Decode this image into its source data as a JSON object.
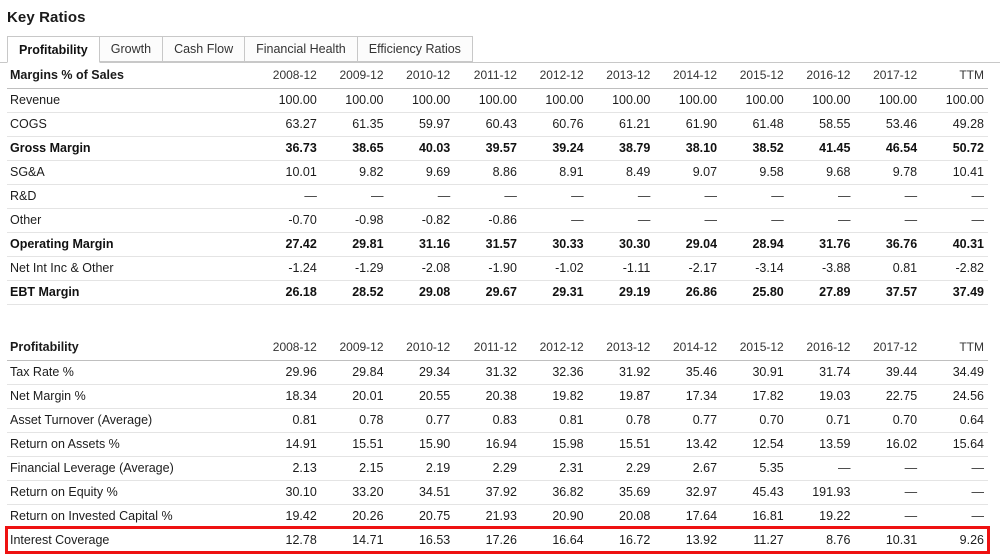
{
  "page_title": "Key Ratios",
  "tabs": [
    {
      "label": "Profitability",
      "active": true
    },
    {
      "label": "Growth",
      "active": false
    },
    {
      "label": "Cash Flow",
      "active": false
    },
    {
      "label": "Financial Health",
      "active": false
    },
    {
      "label": "Efficiency Ratios",
      "active": false
    }
  ],
  "columns": [
    "2008-12",
    "2009-12",
    "2010-12",
    "2011-12",
    "2012-12",
    "2013-12",
    "2014-12",
    "2015-12",
    "2016-12",
    "2017-12",
    "TTM"
  ],
  "highlight_color": "#ee1111",
  "sections": [
    {
      "header": "Margins % of Sales",
      "rows": [
        {
          "label": "Revenue",
          "bold": false,
          "highlight": false,
          "values": [
            "100.00",
            "100.00",
            "100.00",
            "100.00",
            "100.00",
            "100.00",
            "100.00",
            "100.00",
            "100.00",
            "100.00",
            "100.00"
          ]
        },
        {
          "label": "COGS",
          "bold": false,
          "highlight": false,
          "values": [
            "63.27",
            "61.35",
            "59.97",
            "60.43",
            "60.76",
            "61.21",
            "61.90",
            "61.48",
            "58.55",
            "53.46",
            "49.28"
          ]
        },
        {
          "label": "Gross Margin",
          "bold": true,
          "highlight": false,
          "values": [
            "36.73",
            "38.65",
            "40.03",
            "39.57",
            "39.24",
            "38.79",
            "38.10",
            "38.52",
            "41.45",
            "46.54",
            "50.72"
          ]
        },
        {
          "label": "SG&A",
          "bold": false,
          "highlight": false,
          "values": [
            "10.01",
            "9.82",
            "9.69",
            "8.86",
            "8.91",
            "8.49",
            "9.07",
            "9.58",
            "9.68",
            "9.78",
            "10.41"
          ]
        },
        {
          "label": "R&D",
          "bold": false,
          "highlight": false,
          "values": [
            "—",
            "—",
            "—",
            "—",
            "—",
            "—",
            "—",
            "—",
            "—",
            "—",
            "—"
          ]
        },
        {
          "label": "Other",
          "bold": false,
          "highlight": false,
          "values": [
            "-0.70",
            "-0.98",
            "-0.82",
            "-0.86",
            "—",
            "—",
            "—",
            "—",
            "—",
            "—",
            "—"
          ]
        },
        {
          "label": "Operating Margin",
          "bold": true,
          "highlight": false,
          "values": [
            "27.42",
            "29.81",
            "31.16",
            "31.57",
            "30.33",
            "30.30",
            "29.04",
            "28.94",
            "31.76",
            "36.76",
            "40.31"
          ]
        },
        {
          "label": "Net Int Inc & Other",
          "bold": false,
          "highlight": false,
          "values": [
            "-1.24",
            "-1.29",
            "-2.08",
            "-1.90",
            "-1.02",
            "-1.11",
            "-2.17",
            "-3.14",
            "-3.88",
            "0.81",
            "-2.82"
          ]
        },
        {
          "label": "EBT Margin",
          "bold": true,
          "highlight": false,
          "values": [
            "26.18",
            "28.52",
            "29.08",
            "29.67",
            "29.31",
            "29.19",
            "26.86",
            "25.80",
            "27.89",
            "37.57",
            "37.49"
          ]
        }
      ]
    },
    {
      "header": "Profitability",
      "rows": [
        {
          "label": "Tax Rate %",
          "bold": false,
          "highlight": false,
          "values": [
            "29.96",
            "29.84",
            "29.34",
            "31.32",
            "32.36",
            "31.92",
            "35.46",
            "30.91",
            "31.74",
            "39.44",
            "34.49"
          ]
        },
        {
          "label": "Net Margin %",
          "bold": false,
          "highlight": false,
          "values": [
            "18.34",
            "20.01",
            "20.55",
            "20.38",
            "19.82",
            "19.87",
            "17.34",
            "17.82",
            "19.03",
            "22.75",
            "24.56"
          ]
        },
        {
          "label": "Asset Turnover (Average)",
          "bold": false,
          "highlight": false,
          "values": [
            "0.81",
            "0.78",
            "0.77",
            "0.83",
            "0.81",
            "0.78",
            "0.77",
            "0.70",
            "0.71",
            "0.70",
            "0.64"
          ]
        },
        {
          "label": "Return on Assets %",
          "bold": false,
          "highlight": false,
          "values": [
            "14.91",
            "15.51",
            "15.90",
            "16.94",
            "15.98",
            "15.51",
            "13.42",
            "12.54",
            "13.59",
            "16.02",
            "15.64"
          ]
        },
        {
          "label": "Financial Leverage (Average)",
          "bold": false,
          "highlight": false,
          "values": [
            "2.13",
            "2.15",
            "2.19",
            "2.29",
            "2.31",
            "2.29",
            "2.67",
            "5.35",
            "—",
            "—",
            "—"
          ]
        },
        {
          "label": "Return on Equity %",
          "bold": false,
          "highlight": false,
          "values": [
            "30.10",
            "33.20",
            "34.51",
            "37.92",
            "36.82",
            "35.69",
            "32.97",
            "45.43",
            "191.93",
            "—",
            "—"
          ]
        },
        {
          "label": "Return on Invested Capital %",
          "bold": false,
          "highlight": false,
          "values": [
            "19.42",
            "20.26",
            "20.75",
            "21.93",
            "20.90",
            "20.08",
            "17.64",
            "16.81",
            "19.22",
            "—",
            "—"
          ]
        },
        {
          "label": "Interest Coverage",
          "bold": false,
          "highlight": true,
          "values": [
            "12.78",
            "14.71",
            "16.53",
            "17.26",
            "16.64",
            "16.72",
            "13.92",
            "11.27",
            "8.76",
            "10.31",
            "9.26"
          ]
        }
      ]
    }
  ]
}
